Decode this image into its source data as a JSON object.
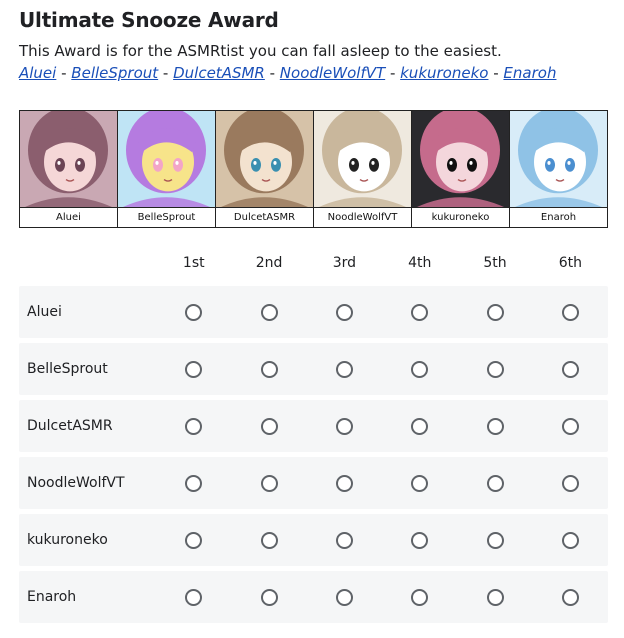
{
  "title": "Ultimate Snooze Award",
  "description": "This Award is for the ASMRtist you can fall asleep to the easiest.",
  "links": [
    "Aluei",
    "BelleSprout",
    "DulcetASMR",
    "NoodleWolfVT",
    "kukuroneko",
    "Enaroh"
  ],
  "link_separator": " - ",
  "banner": [
    {
      "name": "Aluei",
      "palette": [
        "#c9a8b3",
        "#8b5e6e",
        "#f5d7d7",
        "#6b4455"
      ]
    },
    {
      "name": "BelleSprout",
      "palette": [
        "#bfe4f5",
        "#b57be0",
        "#f7e48a",
        "#f3a5c8"
      ]
    },
    {
      "name": "DulcetASMR",
      "palette": [
        "#d6c2a8",
        "#9a7a5e",
        "#f3e2cf",
        "#3a8fb0"
      ]
    },
    {
      "name": "NoodleWolfVT",
      "palette": [
        "#efe9df",
        "#c9b79c",
        "#ffffff",
        "#222222"
      ]
    },
    {
      "name": "kukuroneko",
      "palette": [
        "#2a2a2e",
        "#c56b8c",
        "#f4d6dc",
        "#111111"
      ]
    },
    {
      "name": "Enaroh",
      "palette": [
        "#d8ecf8",
        "#8fc2e6",
        "#ffffff",
        "#4b8fd0"
      ]
    }
  ],
  "columns": [
    "1st",
    "2nd",
    "3rd",
    "4th",
    "5th",
    "6th"
  ],
  "rows": [
    "Aluei",
    "BelleSprout",
    "DulcetASMR",
    "NoodleWolfVT",
    "kukuroneko",
    "Enaroh"
  ]
}
